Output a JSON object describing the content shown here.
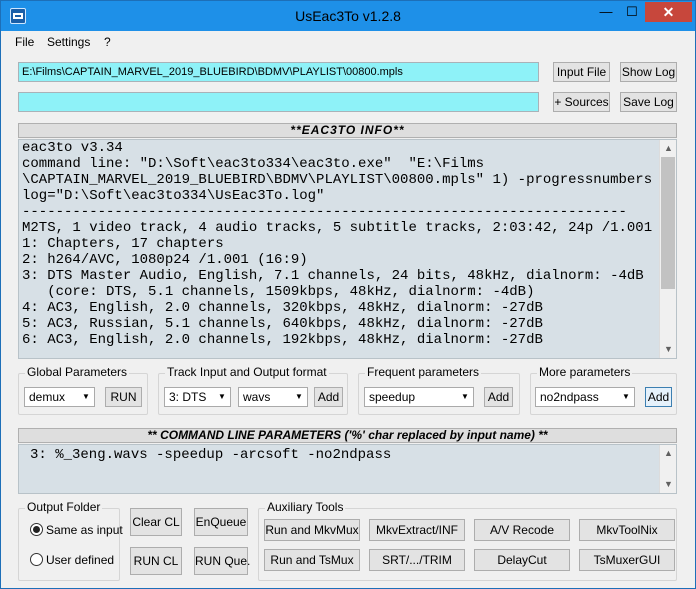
{
  "window": {
    "title": "UsEac3To v1.2.8",
    "controls": {
      "minimize": "—",
      "maximize": "☐",
      "close": "✕"
    }
  },
  "menu": [
    "File",
    "Settings",
    "?"
  ],
  "inputs": {
    "file_path": "E:\\Films\\CAPTAIN_MARVEL_2019_BLUEBIRD\\BDMV\\PLAYLIST\\00800.mpls",
    "sources_path": ""
  },
  "buttons": {
    "input_file": "Input File",
    "show_log": "Show Log",
    "sources": "+ Sources",
    "save_log": "Save Log"
  },
  "info_panel": {
    "title": "**EAC3TO INFO**",
    "lines": [
      "eac3to v3.34",
      "command line: \"D:\\Soft\\eac3to334\\eac3to.exe\"  \"E:\\Films",
      "\\CAPTAIN_MARVEL_2019_BLUEBIRD\\BDMV\\PLAYLIST\\00800.mpls\" 1) -progressnumbers -",
      "log=\"D:\\Soft\\eac3to334\\UsEac3To.log\"",
      "------------------------------------------------------------------------",
      "M2TS, 1 video track, 4 audio tracks, 5 subtitle tracks, 2:03:42, 24p /1.001",
      "1: Chapters, 17 chapters",
      "2: h264/AVC, 1080p24 /1.001 (16:9)",
      "3: DTS Master Audio, English, 7.1 channels, 24 bits, 48kHz, dialnorm: -4dB",
      "   (core: DTS, 5.1 channels, 1509kbps, 48kHz, dialnorm: -4dB)",
      "4: AC3, English, 2.0 channels, 320kbps, 48kHz, dialnorm: -27dB",
      "5: AC3, Russian, 5.1 channels, 640kbps, 48kHz, dialnorm: -27dB",
      "6: AC3, English, 2.0 channels, 192kbps, 48kHz, dialnorm: -27dB"
    ]
  },
  "global_params": {
    "label": "Global Parameters",
    "selected": "demux",
    "run_button": "RUN"
  },
  "track_io": {
    "label": "Track Input and Output format",
    "track_selected": "3: DTS",
    "format_selected": "wavs",
    "add_button": "Add"
  },
  "frequent_params": {
    "label": "Frequent parameters",
    "selected": "speedup",
    "add_button": "Add"
  },
  "more_params": {
    "label": "More parameters",
    "selected": "no2ndpass",
    "add_button": "Add"
  },
  "command_panel": {
    "title": "** COMMAND LINE PARAMETERS ('%' char replaced by input name) **",
    "line": "3: %_3eng.wavs -speedup -arcsoft -no2ndpass"
  },
  "output_folder": {
    "label": "Output Folder",
    "option_same": "Same as input",
    "option_user": "User defined",
    "selected": "same"
  },
  "action_buttons": {
    "clear_cl": "Clear CL",
    "enqueue": "EnQueue",
    "run_cl": "RUN CL",
    "run_queue": "RUN Que."
  },
  "aux_tools": {
    "label": "Auxiliary Tools",
    "buttons": {
      "run_mkvmux": "Run and MkvMux",
      "mkvextract": "MkvExtract/INF",
      "av_recode": "A/V Recode",
      "mkvtoolnix": "MkvToolNix",
      "run_tsmux": "Run and TsMux",
      "srt_trim": "SRT/.../TRIM",
      "delaycut": "DelayCut",
      "tsmuxergui": "TsMuxerGUI"
    }
  },
  "colors": {
    "titlebar": "#1e90e8",
    "close_button": "#c7473c",
    "path_field": "#8ef2f8",
    "log_background": "#d7e0e6"
  }
}
